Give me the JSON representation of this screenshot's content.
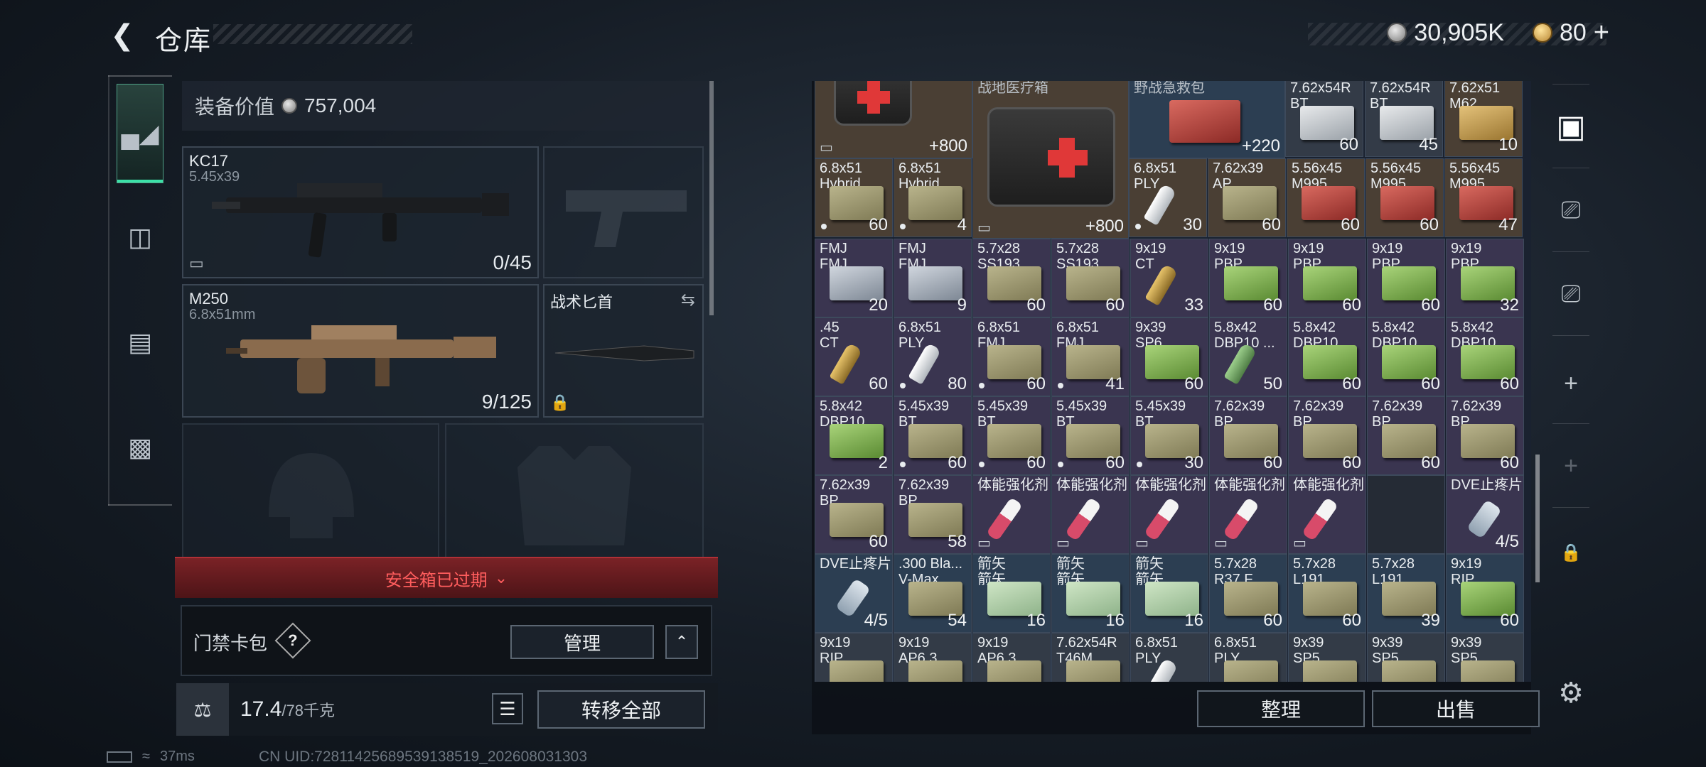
{
  "header": {
    "back_icon": "chevron-left-icon",
    "title": "仓库"
  },
  "currency": {
    "silver": "30,905K",
    "gold": "80",
    "gold_plus": "+"
  },
  "equipment": {
    "value_label": "装备价值",
    "value": "757,004",
    "primary": {
      "name": "KC17",
      "caliber": "5.45x39",
      "count": "0/45"
    },
    "secondary": {
      "name": "M250",
      "caliber": "6.8x51mm",
      "count": "9/125"
    },
    "melee": {
      "name": "战术匕首"
    }
  },
  "safe_box": {
    "status": "安全箱已过期"
  },
  "keycard": {
    "label": "门禁卡包",
    "help": "?",
    "manage": "管理"
  },
  "weight": {
    "current": "17.4",
    "max": "/78千克"
  },
  "actions": {
    "transfer_all": "转移全部",
    "sort": "整理",
    "sell": "出售"
  },
  "status": {
    "ping": "37ms",
    "uid": "CN UID:72811425689539138519_202608031303"
  },
  "grid": {
    "row0": [
      {
        "n1": "",
        "n2": "",
        "q": "800",
        "plus": "+"
      },
      {
        "n1": "战地医疗箱",
        "n2": "",
        "q": "800",
        "plus": "+"
      },
      {
        "n1": "野战急救包",
        "n2": "",
        "q": "220",
        "plus": "+"
      },
      {
        "n1": "7.62x54R",
        "n2": "BT",
        "q": "60"
      },
      {
        "n1": "7.62x54R",
        "n2": "BT",
        "q": "45"
      },
      {
        "n1": "7.62x51",
        "n2": "M62",
        "q": "10"
      }
    ],
    "row1": [
      {
        "n1": "6.8x51",
        "n2": "Hybrid",
        "q": "60"
      },
      {
        "n1": "6.8x51",
        "n2": "Hybrid",
        "q": "4"
      },
      {
        "n1": "6.8x51",
        "n2": "PLY",
        "q": "30"
      },
      {
        "n1": "7.62x39",
        "n2": "AP",
        "q": "60"
      },
      {
        "n1": "5.56x45",
        "n2": "M995",
        "q": "60"
      },
      {
        "n1": "5.56x45",
        "n2": "M995",
        "q": "60"
      },
      {
        "n1": "5.56x45",
        "n2": "M995",
        "q": "47"
      }
    ],
    "row2": [
      {
        "n1": "FMJ",
        "n2": "FMJ",
        "q": "20"
      },
      {
        "n1": "FMJ",
        "n2": "FMJ",
        "q": "9"
      },
      {
        "n1": "5.7x28",
        "n2": "SS193",
        "q": "60"
      },
      {
        "n1": "5.7x28",
        "n2": "SS193",
        "q": "60"
      },
      {
        "n1": "9x19",
        "n2": "CT",
        "q": "33"
      },
      {
        "n1": "9x19",
        "n2": "PBP",
        "q": "60"
      },
      {
        "n1": "9x19",
        "n2": "PBP",
        "q": "60"
      },
      {
        "n1": "9x19",
        "n2": "PBP",
        "q": "60"
      },
      {
        "n1": "9x19",
        "n2": "PBP",
        "q": "32"
      }
    ],
    "row3": [
      {
        "n1": ".45",
        "n2": "CT",
        "q": "60"
      },
      {
        "n1": "6.8x51",
        "n2": "PLY",
        "q": "80"
      },
      {
        "n1": "6.8x51",
        "n2": "FMJ",
        "q": "60"
      },
      {
        "n1": "6.8x51",
        "n2": "FMJ",
        "q": "41"
      },
      {
        "n1": "9x39",
        "n2": "SP6",
        "q": "60"
      },
      {
        "n1": "5.8x42",
        "n2": "DBP10 ...",
        "q": "50"
      },
      {
        "n1": "5.8x42",
        "n2": "DBP10",
        "q": "60"
      },
      {
        "n1": "5.8x42",
        "n2": "DBP10",
        "q": "60"
      },
      {
        "n1": "5.8x42",
        "n2": "DBP10",
        "q": "60"
      }
    ],
    "row4": [
      {
        "n1": "5.8x42",
        "n2": "DBP10",
        "q": "2"
      },
      {
        "n1": "5.45x39",
        "n2": "BT",
        "q": "60"
      },
      {
        "n1": "5.45x39",
        "n2": "BT",
        "q": "60"
      },
      {
        "n1": "5.45x39",
        "n2": "BT",
        "q": "60"
      },
      {
        "n1": "5.45x39",
        "n2": "BT",
        "q": "30"
      },
      {
        "n1": "7.62x39",
        "n2": "BP",
        "q": "60"
      },
      {
        "n1": "7.62x39",
        "n2": "BP",
        "q": "60"
      },
      {
        "n1": "7.62x39",
        "n2": "BP",
        "q": "60"
      },
      {
        "n1": "7.62x39",
        "n2": "BP",
        "q": "60"
      }
    ],
    "row5": [
      {
        "n1": "7.62x39",
        "n2": "BP",
        "q": "60"
      },
      {
        "n1": "7.62x39",
        "n2": "BP",
        "q": "58"
      },
      {
        "n1": "体能强化剂",
        "n2": "",
        "q": ""
      },
      {
        "n1": "体能强化剂",
        "n2": "",
        "q": ""
      },
      {
        "n1": "体能强化剂",
        "n2": "",
        "q": ""
      },
      {
        "n1": "体能强化剂",
        "n2": "",
        "q": ""
      },
      {
        "n1": "体能强化剂",
        "n2": "",
        "q": ""
      },
      {
        "n1": "",
        "n2": "",
        "q": ""
      },
      {
        "n1": "DVE止疼片",
        "n2": "",
        "q": "4/5"
      }
    ],
    "row6": [
      {
        "n1": "DVE止疼片",
        "n2": "",
        "q": "4/5"
      },
      {
        "n1": ".300 Bla...",
        "n2": "V-Max",
        "q": "54"
      },
      {
        "n1": "箭矢",
        "n2": "箭矢",
        "q": "16"
      },
      {
        "n1": "箭矢",
        "n2": "箭矢",
        "q": "16"
      },
      {
        "n1": "箭矢",
        "n2": "箭矢",
        "q": "16"
      },
      {
        "n1": "5.7x28",
        "n2": "R37.F",
        "q": "60"
      },
      {
        "n1": "5.7x28",
        "n2": "L191",
        "q": "60"
      },
      {
        "n1": "5.7x28",
        "n2": "L191",
        "q": "39"
      },
      {
        "n1": "9x19",
        "n2": "RIP",
        "q": "60"
      }
    ],
    "row7": [
      {
        "n1": "9x19",
        "n2": "RIP"
      },
      {
        "n1": "9x19",
        "n2": "AP6.3"
      },
      {
        "n1": "9x19",
        "n2": "AP6.3"
      },
      {
        "n1": "7.62x54R",
        "n2": "T46M"
      },
      {
        "n1": "6.8x51",
        "n2": "PLY"
      },
      {
        "n1": "6.8x51",
        "n2": "PLY"
      },
      {
        "n1": "9x39",
        "n2": "SP5"
      },
      {
        "n1": "9x39",
        "n2": "SP5"
      },
      {
        "n1": "9x39",
        "n2": "SP5"
      }
    ]
  }
}
